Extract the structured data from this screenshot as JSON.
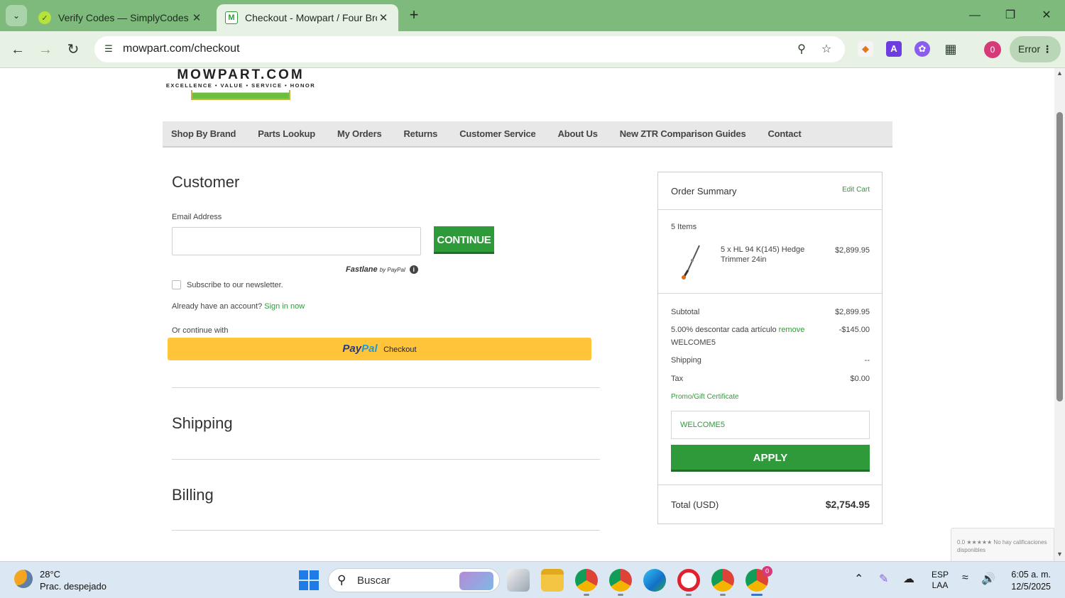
{
  "browser": {
    "tabs": [
      {
        "title": "Verify Codes — SimplyCodes",
        "icon": "simplycodes-icon"
      },
      {
        "title": "Checkout - Mowpart / Four Bro",
        "icon": "mowpart-icon"
      }
    ],
    "url": "mowpart.com/checkout",
    "error_label": "Error",
    "profile_badge": "0"
  },
  "logo": {
    "title": "MOWPART.COM",
    "tagline": "EXCELLENCE • VALUE • SERVICE • HONOR"
  },
  "nav": [
    "Shop By Brand",
    "Parts Lookup",
    "My Orders",
    "Returns",
    "Customer Service",
    "About Us",
    "New ZTR Comparison Guides",
    "Contact"
  ],
  "customer": {
    "title": "Customer",
    "email_label": "Email Address",
    "email_value": "",
    "continue_label": "CONTINUE",
    "fastlane": "Fastlane",
    "fastlane_by": "by PayPal",
    "newsletter_label": "Subscribe to our newsletter.",
    "already_text": "Already have an account?",
    "sign_in_label": "Sign in now",
    "or_continue": "Or continue with",
    "paypal_pay": "Pay",
    "paypal_pal": "Pal",
    "paypal_checkout": "Checkout"
  },
  "sections": {
    "shipping": "Shipping",
    "billing": "Billing"
  },
  "summary": {
    "title": "Order Summary",
    "edit_cart": "Edit Cart",
    "items_count": "5 Items",
    "item_name": "5 x HL 94 K(145) Hedge Trimmer 24in",
    "item_price": "$2,899.95",
    "subtotal_label": "Subtotal",
    "subtotal_value": "$2,899.95",
    "discount_label": "5.00% descontar cada artículo",
    "discount_remove": "remove",
    "discount_code": "WELCOME5",
    "discount_value": "-$145.00",
    "shipping_label": "Shipping",
    "shipping_value": "--",
    "tax_label": "Tax",
    "tax_value": "$0.00",
    "promo_label": "Promo/Gift Certificate",
    "promo_value": "WELCOME5",
    "apply_label": "APPLY",
    "total_label": "Total (USD)",
    "total_value": "$2,754.95"
  },
  "recaptcha_text": "0.0 ★★★★★ No hay calificaciones disponibles",
  "taskbar": {
    "temp": "28°C",
    "weather": "Prac. despejado",
    "search_label": "Buscar",
    "lang_top": "ESP",
    "lang_bottom": "LAA",
    "time": "6:05 a. m.",
    "date": "12/5/2025",
    "chrome_badge": "0"
  },
  "colors": {
    "brand_green": "#2f9a3a",
    "chrome_green": "#7dba7c",
    "paypal_yellow": "#ffc43a"
  }
}
